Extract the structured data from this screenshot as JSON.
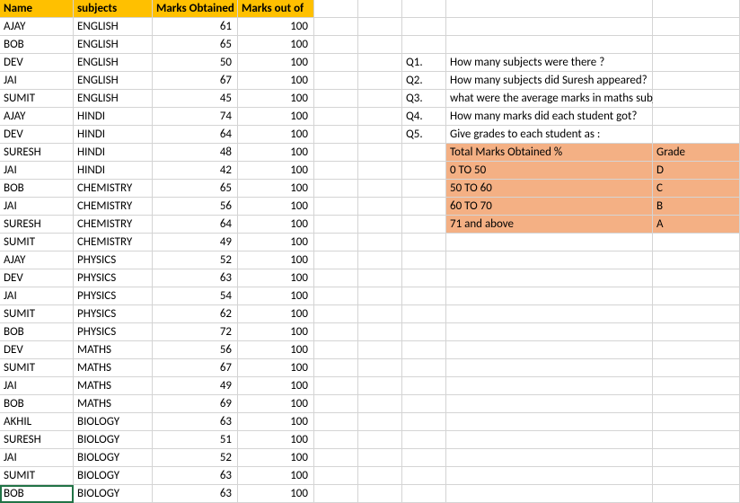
{
  "headers": [
    "Name",
    "subjects",
    "Marks Obtained",
    "Marks out of",
    "",
    "",
    "",
    "",
    ""
  ],
  "rows": [
    [
      "AJAY",
      "ENGLISH",
      "61",
      "100",
      "",
      "",
      "",
      "",
      ""
    ],
    [
      "BOB",
      "ENGLISH",
      "65",
      "100",
      "",
      "",
      "",
      "",
      ""
    ],
    [
      "DEV",
      "ENGLISH",
      "50",
      "100",
      "",
      "",
      "Q1.",
      "How many subjects were there ?",
      ""
    ],
    [
      "JAI",
      "ENGLISH",
      "67",
      "100",
      "",
      "",
      "Q2.",
      "How many subjects did Suresh appeared?",
      ""
    ],
    [
      "SUMIT",
      "ENGLISH",
      "45",
      "100",
      "",
      "",
      "Q3.",
      "what were the average marks in maths subject?",
      ""
    ],
    [
      "AJAY",
      "HINDI",
      "74",
      "100",
      "",
      "",
      "Q4.",
      "How many marks did each student got?",
      ""
    ],
    [
      "DEV",
      "HINDI",
      "64",
      "100",
      "",
      "",
      "Q5.",
      "Give grades to each student as :",
      ""
    ],
    [
      "SURESH",
      "HINDI",
      "48",
      "100",
      "",
      "",
      "",
      "Total Marks Obtained %",
      "Grade"
    ],
    [
      "JAI",
      "HINDI",
      "42",
      "100",
      "",
      "",
      "",
      "0 TO 50",
      "D"
    ],
    [
      "BOB",
      "CHEMISTRY",
      "65",
      "100",
      "",
      "",
      "",
      "50 TO 60",
      "C"
    ],
    [
      "JAI",
      "CHEMISTRY",
      "56",
      "100",
      "",
      "",
      "",
      "60 TO 70",
      "B"
    ],
    [
      "SURESH",
      "CHEMISTRY",
      "64",
      "100",
      "",
      "",
      "",
      "71 and above",
      "A"
    ],
    [
      "SUMIT",
      "CHEMISTRY",
      "49",
      "100",
      "",
      "",
      "",
      "",
      ""
    ],
    [
      "AJAY",
      "PHYSICS",
      "52",
      "100",
      "",
      "",
      "",
      "",
      ""
    ],
    [
      "DEV",
      "PHYSICS",
      "63",
      "100",
      "",
      "",
      "",
      "",
      ""
    ],
    [
      "JAI",
      "PHYSICS",
      "54",
      "100",
      "",
      "",
      "",
      "",
      ""
    ],
    [
      "SUMIT",
      "PHYSICS",
      "62",
      "100",
      "",
      "",
      "",
      "",
      ""
    ],
    [
      "BOB",
      "PHYSICS",
      "72",
      "100",
      "",
      "",
      "",
      "",
      ""
    ],
    [
      "DEV",
      "MATHS",
      "56",
      "100",
      "",
      "",
      "",
      "",
      ""
    ],
    [
      "SUMIT",
      "MATHS",
      "67",
      "100",
      "",
      "",
      "",
      "",
      ""
    ],
    [
      "JAI",
      "MATHS",
      "49",
      "100",
      "",
      "",
      "",
      "",
      ""
    ],
    [
      "BOB",
      "MATHS",
      "69",
      "100",
      "",
      "",
      "",
      "",
      ""
    ],
    [
      "AKHIL",
      "BIOLOGY",
      "63",
      "100",
      "",
      "",
      "",
      "",
      ""
    ],
    [
      "SURESH",
      "BIOLOGY",
      "51",
      "100",
      "",
      "",
      "",
      "",
      ""
    ],
    [
      "JAI",
      "BIOLOGY",
      "52",
      "100",
      "",
      "",
      "",
      "",
      ""
    ],
    [
      "SUMIT",
      "BIOLOGY",
      "63",
      "100",
      "",
      "",
      "",
      "",
      ""
    ],
    [
      "BOB",
      "BIOLOGY",
      "63",
      "100",
      "",
      "",
      "",
      "",
      ""
    ]
  ],
  "numericCols": [
    2,
    3
  ],
  "peachCells": [
    [
      7,
      7
    ],
    [
      7,
      8
    ],
    [
      8,
      7
    ],
    [
      8,
      8
    ],
    [
      9,
      7
    ],
    [
      9,
      8
    ],
    [
      10,
      7
    ],
    [
      10,
      8
    ],
    [
      11,
      7
    ],
    [
      11,
      8
    ]
  ],
  "overflowCells": [
    [
      2,
      7
    ],
    [
      3,
      7
    ],
    [
      4,
      7
    ],
    [
      5,
      7
    ],
    [
      6,
      7
    ]
  ],
  "activeCell": [
    26,
    0
  ]
}
